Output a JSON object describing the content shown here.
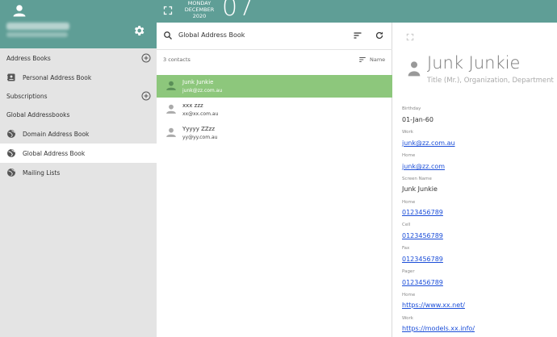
{
  "topbar": {
    "day": "MONDAY",
    "month": "DECEMBER",
    "year": "2020",
    "date": "07"
  },
  "sidebar": {
    "user": {
      "name": "INC-TM Phones",
      "email": "contact@example.com.au"
    },
    "sections": {
      "address_books": "Address Books",
      "personal": "Personal Address Book",
      "subscriptions": "Subscriptions",
      "global_addressbooks": "Global Addressbooks",
      "domain": "Domain Address Book",
      "global": "Global Address Book",
      "mailing_lists": "Mailing Lists"
    }
  },
  "list": {
    "title": "Global Address Book",
    "count": "3 contacts",
    "sort_label": "Name",
    "contacts": [
      {
        "name": "Junk Junkie",
        "email": "junk@zz.com.au"
      },
      {
        "name": "xxx zzz",
        "email": "xx@xx.com.au"
      },
      {
        "name": "Yyyyy ZZzz",
        "email": "yy@yy.com.au"
      }
    ]
  },
  "detail": {
    "name": "Junk Junkie",
    "title": "Title (Mr.), Organization, Department",
    "fields": [
      {
        "label": "Birthday",
        "value": "01-Jan-60",
        "link": false
      },
      {
        "label": "Work",
        "value": "junk@zz.com.au",
        "link": true
      },
      {
        "label": "Home",
        "value": "junk@zz.com",
        "link": true
      },
      {
        "label": "Screen Name",
        "value": "Junk Junkie",
        "link": false
      },
      {
        "label": "Home",
        "value": "0123456789",
        "link": true
      },
      {
        "label": "Cell",
        "value": "0123456789",
        "link": true
      },
      {
        "label": "Fax",
        "value": "0123456789",
        "link": true
      },
      {
        "label": "Pager",
        "value": "0123456789",
        "link": true
      },
      {
        "label": "Home",
        "value": "https://www.xx.net/",
        "link": true
      },
      {
        "label": "Work",
        "value": "https://models.xx.info/",
        "link": true
      }
    ]
  },
  "colors": {
    "header": "#5f9e96",
    "selected": "#8dc77c",
    "sidebar": "#e4e4e4",
    "link": "#1a4dd8"
  },
  "icons": [
    "user-icon",
    "gear-icon",
    "plus-circle-icon",
    "contact-card-icon",
    "globe-icon",
    "fullscreen-icon",
    "search-icon",
    "sort-icon",
    "refresh-icon",
    "sort-by-icon",
    "expand-icon"
  ]
}
